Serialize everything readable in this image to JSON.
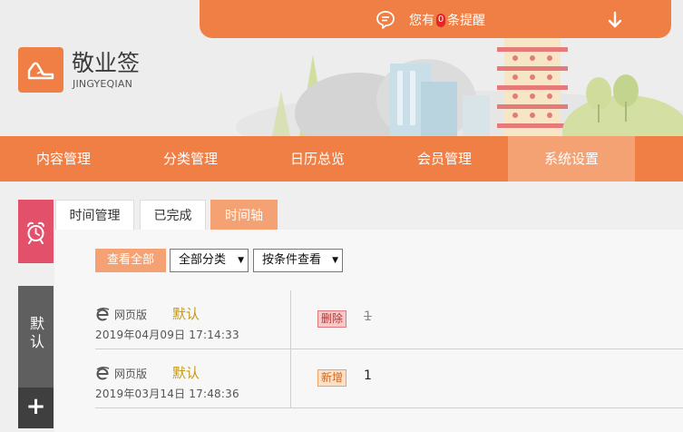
{
  "header": {
    "notification": {
      "prefix": "您有",
      "count": "0",
      "suffix": "条提醒"
    },
    "logo": {
      "title": "敬业签",
      "subtitle": "JINGYEQIAN"
    }
  },
  "nav": {
    "items": [
      {
        "label": "内容管理"
      },
      {
        "label": "分类管理"
      },
      {
        "label": "日历总览"
      },
      {
        "label": "会员管理"
      },
      {
        "label": "系统设置"
      }
    ],
    "active_index": 4
  },
  "sidebar": {
    "alarm_icon": "alarm-clock-icon",
    "default_label": "默认",
    "add_label": "+"
  },
  "tabs": [
    {
      "label": "时间管理"
    },
    {
      "label": "已完成"
    },
    {
      "label": "时间轴"
    }
  ],
  "filters": {
    "view_all": "查看全部",
    "category_select": "全部分类",
    "condition_select": "按条件查看"
  },
  "entries": [
    {
      "source": "网页版",
      "category": "默认",
      "time": "2019年04月09日 17:14:33",
      "action": "删除",
      "content": "1"
    },
    {
      "source": "网页版",
      "category": "默认",
      "time": "2019年03月14日 17:48:36",
      "action": "新增",
      "content": "1"
    }
  ],
  "colors": {
    "accent": "#ef7f45",
    "accent_light": "#f4a273",
    "alarm_tab": "#e3506a",
    "side_dark": "#5f5f5f"
  }
}
